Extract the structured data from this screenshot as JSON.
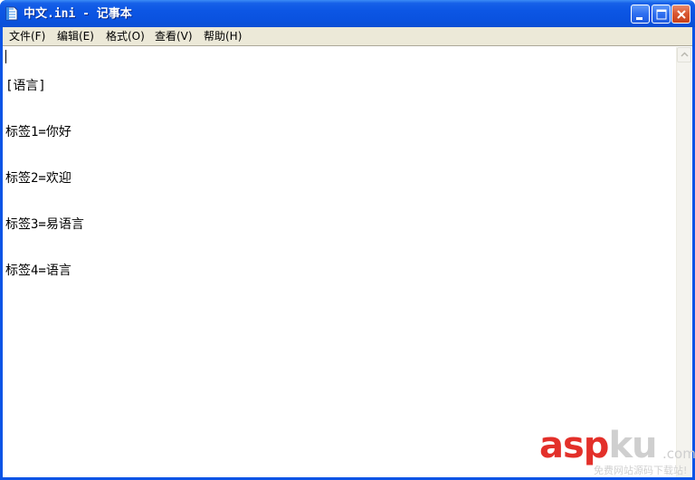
{
  "window": {
    "title": "中文.ini - 记事本",
    "colors": {
      "titlebar": "#0a54e6",
      "menubar": "#ece9d8",
      "close": "#d9562f"
    }
  },
  "titlebar_buttons": {
    "minimize_icon": "minimize-icon",
    "maximize_icon": "maximize-icon",
    "close_icon": "close-icon"
  },
  "menu": {
    "items": [
      {
        "label": "文件(F)"
      },
      {
        "label": "编辑(E)"
      },
      {
        "label": "格式(O)"
      },
      {
        "label": "查看(V)"
      },
      {
        "label": "帮助(H)"
      }
    ]
  },
  "document": {
    "lines": [
      "[语言]",
      "标签1=你好",
      "标签2=欢迎",
      "标签3=易语言",
      "标签4=语言"
    ]
  },
  "watermark": {
    "brand_asp": "asp",
    "brand_ku": "ku",
    "brand_suffix": ".com",
    "tagline": "免费网站源码下载站!",
    "colors": {
      "asp": "#e3302a",
      "ku": "#cfcfcf"
    }
  }
}
